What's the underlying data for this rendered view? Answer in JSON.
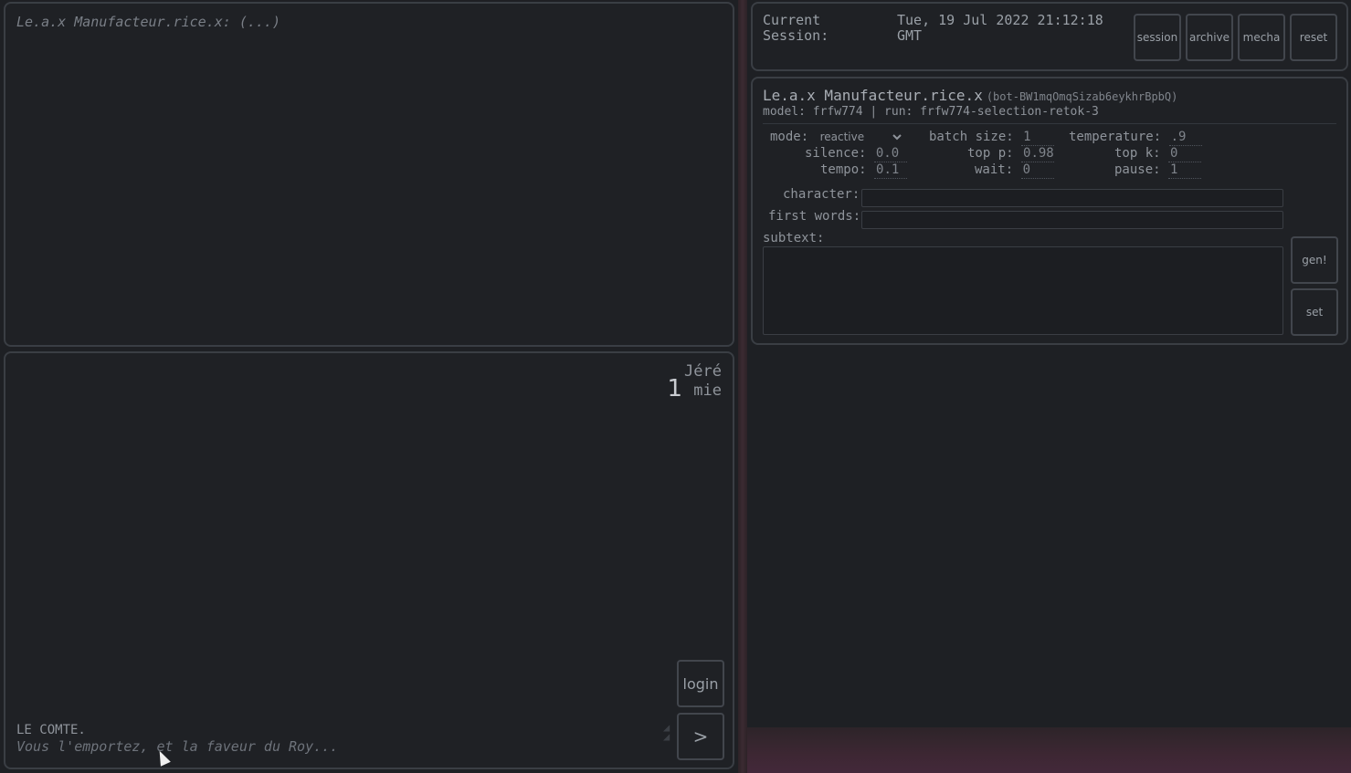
{
  "transcript": {
    "line": "Le.a.x Manufacteur.rice.x: (...)"
  },
  "composer": {
    "counter": "1",
    "speaker_line1": "Jéré",
    "speaker_line2": "mie",
    "character": "LE COMTE.",
    "line_text": "Vous l'emportez, et la faveur du Roy...",
    "login_label": "login",
    "send_label": ">"
  },
  "session": {
    "label_line1": "Current",
    "label_line2": "Session:",
    "time_line1": "Tue, 19 Jul 2022 21:12:18",
    "time_line2": "GMT",
    "buttons": [
      "session",
      "archive",
      "mecha",
      "reset"
    ]
  },
  "bot": {
    "name": "Le.a.x Manufacteur.rice.x",
    "id": "(bot-BW1mqOmqSizab6eykhrBpbQ)",
    "meta": "model: frfw774 | run: frfw774-selection-retok-3",
    "params": {
      "mode_label": "mode:",
      "mode_value": "reactive",
      "batch_size_label": "batch size:",
      "batch_size": "1",
      "temperature_label": "temperature:",
      "temperature": ".9",
      "silence_label": "silence:",
      "silence": "0.0",
      "top_p_label": "top p:",
      "top_p": "0.98",
      "top_k_label": "top k:",
      "top_k": "0",
      "tempo_label": "tempo:",
      "tempo": "0.1",
      "wait_label": "wait:",
      "wait": "0",
      "pause_label": "pause:",
      "pause": "1"
    },
    "character_label": "character:",
    "first_words_label": "first words:",
    "subtext_label": "subtext:",
    "gen_label": "gen!",
    "set_label": "set"
  }
}
